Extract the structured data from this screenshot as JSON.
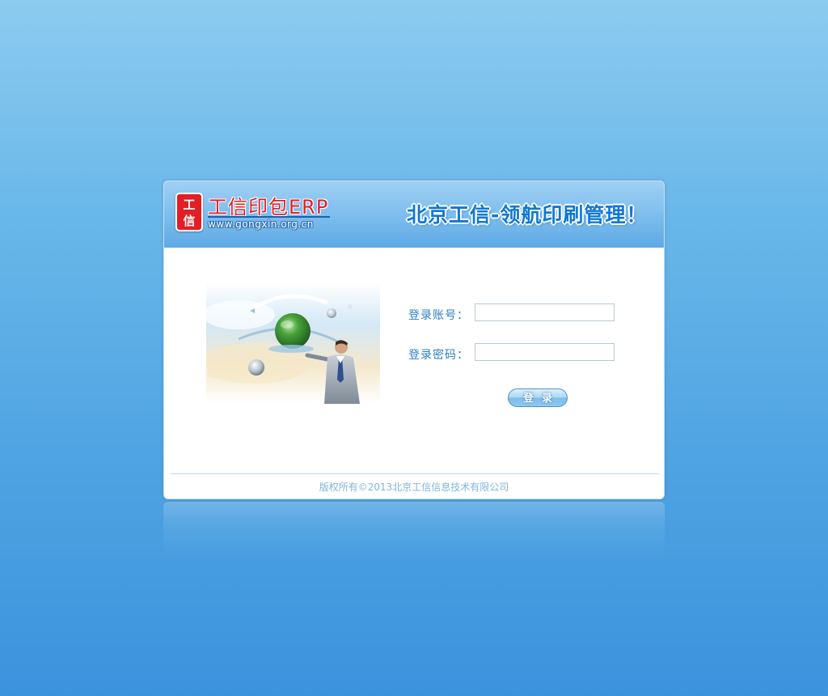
{
  "header": {
    "logo_char_1": "工",
    "logo_char_2": "信",
    "logo_title": "工信印包ERP",
    "logo_url": "www.gongxin.org.cn",
    "slogan": "北京工信-领航印刷管理！"
  },
  "form": {
    "account_label": "登录账号：",
    "account_value": "",
    "password_label": "登录密码：",
    "password_value": "",
    "login_button": "登录"
  },
  "footer": {
    "copyright": "版权所有©2013北京工信信息技术有限公司"
  },
  "colors": {
    "background_top": "#8ccbef",
    "background_bottom": "#3c93dd",
    "logo_red": "#e31e24",
    "slogan_blue": "#0f78d6",
    "label_blue": "#2d7fbf",
    "copyright_blue": "#7fb6d9"
  },
  "icons": {
    "illustration": "businessman-holding-globe-illustration"
  }
}
